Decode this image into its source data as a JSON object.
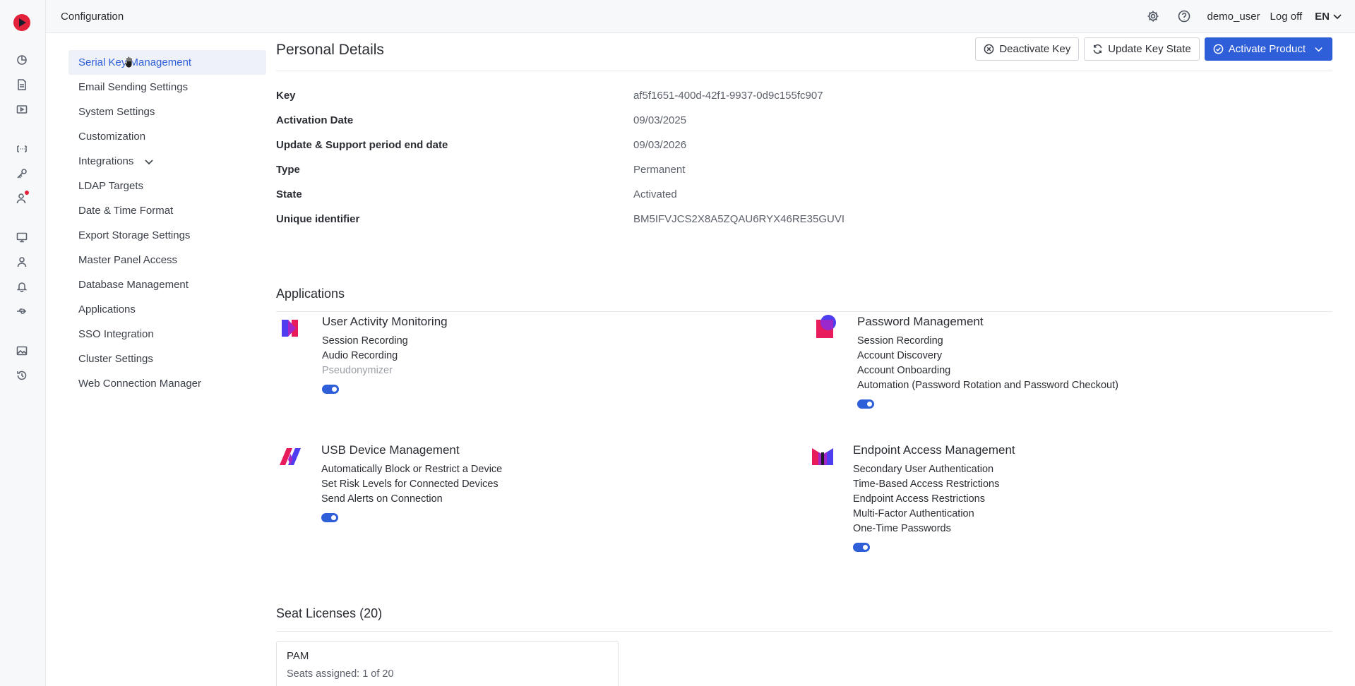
{
  "topbar": {
    "title": "Configuration",
    "user": "demo_user",
    "logoff": "Log off",
    "language": "EN"
  },
  "sidebar": {
    "items": [
      {
        "label": "Serial Key Management",
        "active": true
      },
      {
        "label": "Email Sending Settings"
      },
      {
        "label": "System Settings"
      },
      {
        "label": "Customization"
      },
      {
        "label": "Integrations",
        "expandable": true
      },
      {
        "label": "LDAP Targets"
      },
      {
        "label": "Date & Time Format"
      },
      {
        "label": "Export Storage Settings"
      },
      {
        "label": "Master Panel Access"
      },
      {
        "label": "Database Management"
      },
      {
        "label": "Applications"
      },
      {
        "label": "SSO Integration"
      },
      {
        "label": "Cluster Settings"
      },
      {
        "label": "Web Connection Manager"
      }
    ]
  },
  "main": {
    "title": "Personal Details",
    "actions": {
      "deactivate": "Deactivate Key",
      "update_state": "Update Key State",
      "activate": "Activate Product"
    },
    "details": [
      {
        "label": "Key",
        "value": "af5f1651-400d-42f1-9937-0d9c155fc907"
      },
      {
        "label": "Activation Date",
        "value": "09/03/2025"
      },
      {
        "label": "Update & Support period end date",
        "value": "09/03/2026"
      },
      {
        "label": "Type",
        "value": "Permanent"
      },
      {
        "label": "State",
        "value": "Activated"
      },
      {
        "label": "Unique identifier",
        "value": "BM5IFVJCS2X8A5ZQAU6RYX46RE35GUVI"
      }
    ],
    "applications_title": "Applications",
    "applications": [
      {
        "name": "User Activity Monitoring",
        "features": [
          "Session Recording",
          "Audio Recording",
          "Pseudonymizer"
        ],
        "muted_feature": "Pseudonymizer",
        "enabled": true
      },
      {
        "name": "Password Management",
        "features": [
          "Session Recording",
          "Account Discovery",
          "Account Onboarding",
          "Automation (Password Rotation and Password Checkout)"
        ],
        "enabled": true
      },
      {
        "name": "USB Device Management",
        "features": [
          "Automatically Block or Restrict a Device",
          "Set Risk Levels for Connected Devices",
          "Send Alerts on Connection"
        ],
        "enabled": true
      },
      {
        "name": "Endpoint Access Management",
        "features": [
          "Secondary User Authentication",
          "Time-Based Access Restrictions",
          "Endpoint Access Restrictions",
          "Multi-Factor Authentication",
          "One-Time Passwords"
        ],
        "enabled": true
      }
    ],
    "seat_licenses": {
      "title": "Seat Licenses (20)",
      "cards": [
        {
          "name": "PAM",
          "seats": "Seats assigned: 1 of 20"
        }
      ]
    }
  },
  "colors": {
    "accent": "#2f5fd8",
    "brand_red": "#e5203a"
  }
}
